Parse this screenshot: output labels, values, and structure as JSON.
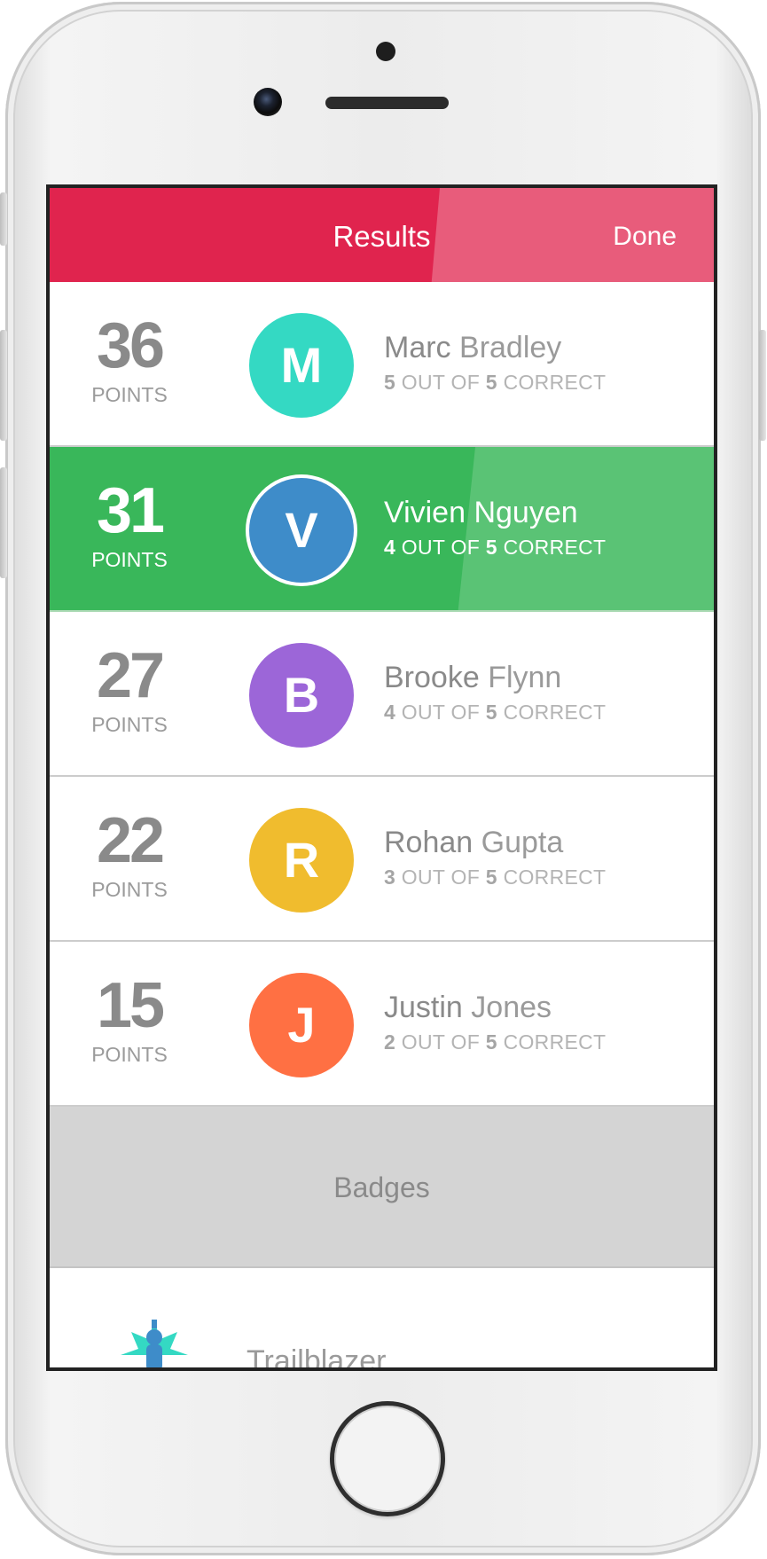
{
  "nav": {
    "title": "Results",
    "done_label": "Done"
  },
  "results": [
    {
      "points": "36",
      "points_label": "POINTS",
      "initial": "M",
      "first_name": "Marc",
      "last_name": "Bradley",
      "correct": "5",
      "out_of_label": "OUT OF",
      "total": "5",
      "correct_label": "CORRECT",
      "color": "#34d9c3",
      "highlighted": false
    },
    {
      "points": "31",
      "points_label": "POINTS",
      "initial": "V",
      "first_name": "Vivien",
      "last_name": "Nguyen",
      "correct": "4",
      "out_of_label": "OUT OF",
      "total": "5",
      "correct_label": "CORRECT",
      "color": "#3e8cc9",
      "highlighted": true
    },
    {
      "points": "27",
      "points_label": "POINTS",
      "initial": "B",
      "first_name": "Brooke",
      "last_name": "Flynn",
      "correct": "4",
      "out_of_label": "OUT OF",
      "total": "5",
      "correct_label": "CORRECT",
      "color": "#9c66d8",
      "highlighted": false
    },
    {
      "points": "22",
      "points_label": "POINTS",
      "initial": "R",
      "first_name": "Rohan",
      "last_name": "Gupta",
      "correct": "3",
      "out_of_label": "OUT OF",
      "total": "5",
      "correct_label": "CORRECT",
      "color": "#f0bc2e",
      "highlighted": false
    },
    {
      "points": "15",
      "points_label": "POINTS",
      "initial": "J",
      "first_name": "Justin",
      "last_name": "Jones",
      "correct": "2",
      "out_of_label": "OUT OF",
      "total": "5",
      "correct_label": "CORRECT",
      "color": "#ff7043",
      "highlighted": false
    }
  ],
  "badges": {
    "header": "Badges",
    "items": [
      {
        "name": "Trailblazer",
        "icon": "trailblazer-badge-icon"
      }
    ]
  }
}
